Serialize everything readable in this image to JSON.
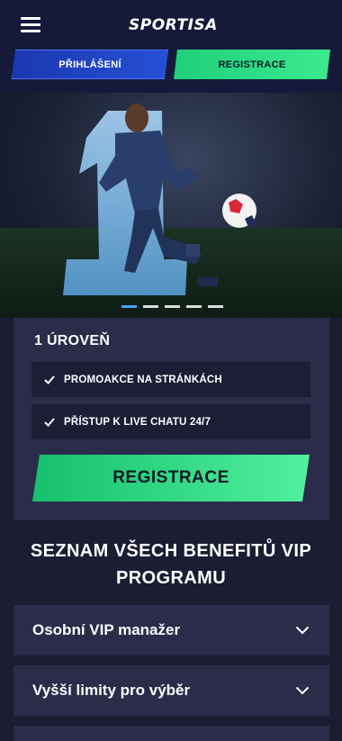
{
  "header": {
    "logo_text": "SPORTISA",
    "login_label": "PŘIHLÁŠENÍ",
    "register_label": "REGISTRACE"
  },
  "hero": {
    "slides_count": 5,
    "active_slide": 1
  },
  "level_card": {
    "title": "1 ÚROVEŇ",
    "benefits": [
      "PROMOAKCE NA STRÁNKÁCH",
      "PŘÍSTUP K LIVE CHATU 24/7"
    ],
    "cta_label": "REGISTRACE"
  },
  "benefits_section": {
    "title_line1": "SEZNAM VŠECH BENEFITŮ VIP",
    "title_line2": "PROGRAMU",
    "items": [
      "Osobní VIP manažer",
      "Vyšší limity pro výběr"
    ]
  },
  "colors": {
    "page_bg": "#1b1d33",
    "header_bg": "#151a3a",
    "card_bg": "#2a2c4a",
    "login_blue": "#2750d6",
    "accent_green": "#3ce98f"
  }
}
